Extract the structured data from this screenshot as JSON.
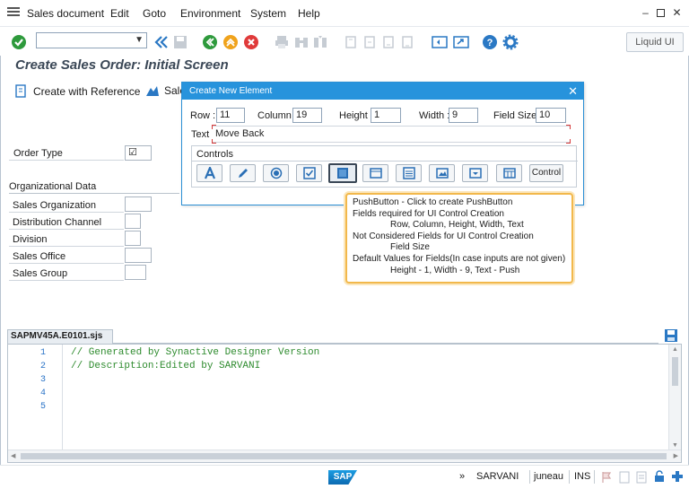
{
  "menu": {
    "items": [
      "Sales document",
      "Edit",
      "Goto",
      "Environment",
      "System",
      "Help"
    ]
  },
  "toolbar": {
    "liquid_ui_label": "Liquid UI",
    "icons": [
      "enter-icon",
      "back-icon",
      "save-icon",
      "exit-icon",
      "up-icon",
      "cancel-icon",
      "print-icon",
      "find-icon",
      "help-icon",
      "settings-icon"
    ]
  },
  "screen": {
    "title": "Create Sales Order: Initial Screen",
    "create_with_reference": "Create with Reference",
    "sales_truncated": "Sale"
  },
  "form": {
    "order_type_label": "Order Type",
    "group_title": "Organizational Data",
    "fields": [
      "Sales Organization",
      "Distribution Channel",
      "Division",
      "Sales Office",
      "Sales Group"
    ]
  },
  "dialog": {
    "title": "Create New Element",
    "row_label": "Row :",
    "row_value": "11",
    "column_label": "Column :",
    "column_value": "19",
    "height_label": "Height :",
    "height_value": "1",
    "width_label": "Width :",
    "width_value": "9",
    "fieldsize_label": "Field Size :",
    "fieldsize_value": "10",
    "text_label": "Text :",
    "text_value": "Move Back",
    "controls_title": "Controls",
    "control_button_label": "Control"
  },
  "tooltip": {
    "lines": [
      "PushButton - Click to create PushButton",
      "Fields required for UI Control Creation",
      "Row, Column, Height, Width, Text",
      "Not Considered Fields for UI Control Creation",
      "Field Size",
      "Default Values for Fields(In case inputs are not given)",
      "Height - 1, Width - 9, Text - Push"
    ]
  },
  "editor": {
    "tab_name": "SAPMV45A.E0101.sjs",
    "line_numbers": [
      "1",
      "2",
      "3",
      "4",
      "5"
    ],
    "code_lines": [
      "// Generated by Synactive Designer Version",
      "// Description:Edited by SARVANI",
      "",
      "",
      ""
    ]
  },
  "status": {
    "sap_logo": "SAP",
    "expand": "»",
    "user": "SARVANI",
    "server": "juneau",
    "mode": "INS"
  },
  "colors": {
    "accent": "#2793dc",
    "title": "#3a4756",
    "tooltip_border": "#f2b84b",
    "code_comment": "#2e8b2e"
  }
}
